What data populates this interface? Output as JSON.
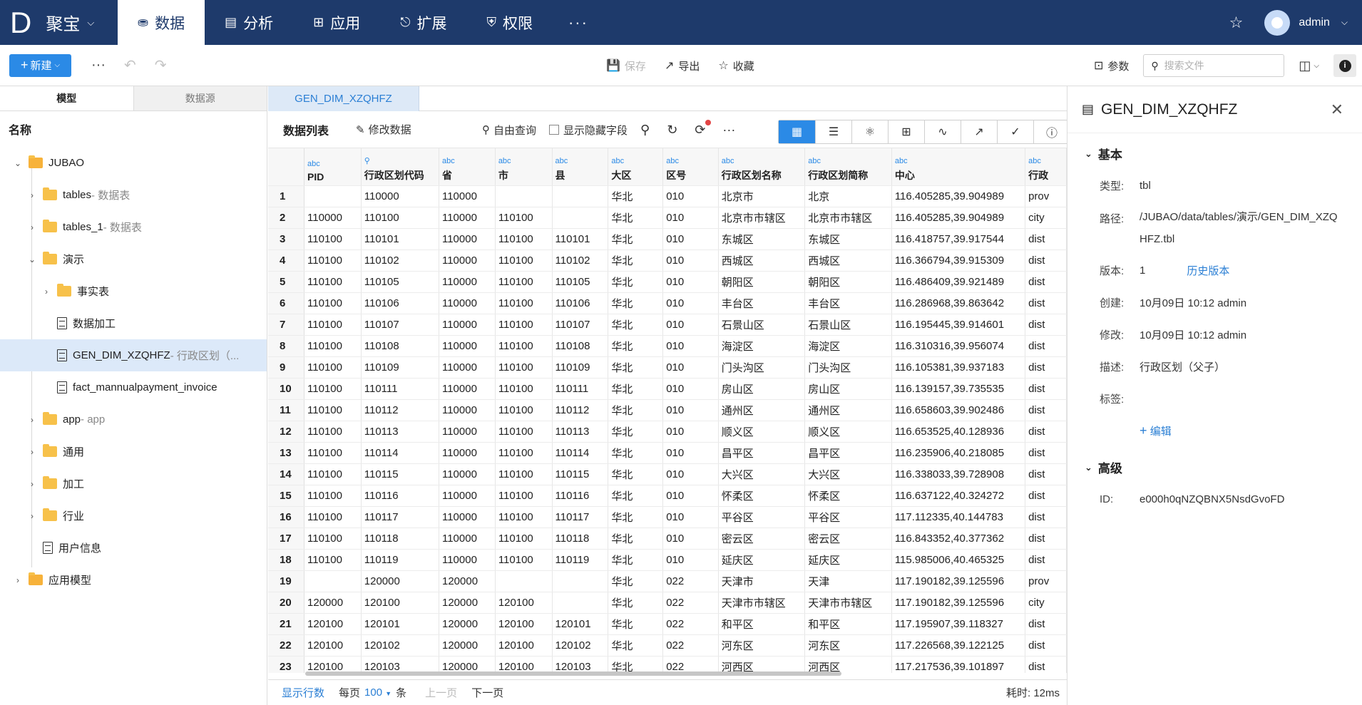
{
  "app": {
    "logo_letter": "D",
    "brand": "聚宝",
    "nav_tabs": [
      {
        "label": "数据",
        "icon": "database-icon"
      },
      {
        "label": "分析",
        "icon": "bar-chart-icon"
      },
      {
        "label": "应用",
        "icon": "apps-icon"
      },
      {
        "label": "扩展",
        "icon": "extension-icon"
      },
      {
        "label": "权限",
        "icon": "shield-icon"
      }
    ],
    "more": "···",
    "user": "admin"
  },
  "toolbar": {
    "new_label": "新建",
    "save_label": "保存",
    "export_label": "导出",
    "favorite_label": "收藏",
    "params_label": "参数",
    "search_placeholder": "搜索文件"
  },
  "left_panel": {
    "tabs": [
      "模型",
      "数据源"
    ],
    "header": "名称",
    "tree": [
      {
        "label": "JUBAO",
        "sub": ""
      },
      {
        "label": "tables",
        "sub": " - 数据表"
      },
      {
        "label": "tables_1",
        "sub": " - 数据表"
      },
      {
        "label": "演示",
        "sub": ""
      },
      {
        "label": "事实表",
        "sub": ""
      },
      {
        "label": "数据加工",
        "sub": ""
      },
      {
        "label": "GEN_DIM_XZQHFZ",
        "sub": " - 行政区划（..."
      },
      {
        "label": "fact_mannualpayment_invoice",
        "sub": ""
      },
      {
        "label": "app",
        "sub": " - app"
      },
      {
        "label": "通用",
        "sub": ""
      },
      {
        "label": "加工",
        "sub": ""
      },
      {
        "label": "行业",
        "sub": ""
      },
      {
        "label": "用户信息",
        "sub": ""
      },
      {
        "label": "应用模型",
        "sub": ""
      }
    ]
  },
  "center": {
    "doc_tab": "GEN_DIM_XZQHFZ",
    "view_title": "数据列表",
    "edit_data": "修改数据",
    "free_query": "自由查询",
    "show_hidden": "显示隐藏字段",
    "type_tag": "abc",
    "columns": [
      "PID",
      "行政区划代码",
      "省",
      "市",
      "县",
      "大区",
      "区号",
      "行政区划名称",
      "行政区划简称",
      "中心",
      "行政"
    ],
    "rows": [
      [
        "1",
        "",
        "110000",
        "110000",
        "",
        "",
        "华北",
        "010",
        "北京市",
        "北京",
        "116.405285,39.904989",
        "prov"
      ],
      [
        "2",
        "110000",
        "110100",
        "110000",
        "110100",
        "",
        "华北",
        "010",
        "北京市市辖区",
        "北京市市辖区",
        "116.405285,39.904989",
        "city"
      ],
      [
        "3",
        "110100",
        "110101",
        "110000",
        "110100",
        "110101",
        "华北",
        "010",
        "东城区",
        "东城区",
        "116.418757,39.917544",
        "dist"
      ],
      [
        "4",
        "110100",
        "110102",
        "110000",
        "110100",
        "110102",
        "华北",
        "010",
        "西城区",
        "西城区",
        "116.366794,39.915309",
        "dist"
      ],
      [
        "5",
        "110100",
        "110105",
        "110000",
        "110100",
        "110105",
        "华北",
        "010",
        "朝阳区",
        "朝阳区",
        "116.486409,39.921489",
        "dist"
      ],
      [
        "6",
        "110100",
        "110106",
        "110000",
        "110100",
        "110106",
        "华北",
        "010",
        "丰台区",
        "丰台区",
        "116.286968,39.863642",
        "dist"
      ],
      [
        "7",
        "110100",
        "110107",
        "110000",
        "110100",
        "110107",
        "华北",
        "010",
        "石景山区",
        "石景山区",
        "116.195445,39.914601",
        "dist"
      ],
      [
        "8",
        "110100",
        "110108",
        "110000",
        "110100",
        "110108",
        "华北",
        "010",
        "海淀区",
        "海淀区",
        "116.310316,39.956074",
        "dist"
      ],
      [
        "9",
        "110100",
        "110109",
        "110000",
        "110100",
        "110109",
        "华北",
        "010",
        "门头沟区",
        "门头沟区",
        "116.105381,39.937183",
        "dist"
      ],
      [
        "10",
        "110100",
        "110111",
        "110000",
        "110100",
        "110111",
        "华北",
        "010",
        "房山区",
        "房山区",
        "116.139157,39.735535",
        "dist"
      ],
      [
        "11",
        "110100",
        "110112",
        "110000",
        "110100",
        "110112",
        "华北",
        "010",
        "通州区",
        "通州区",
        "116.658603,39.902486",
        "dist"
      ],
      [
        "12",
        "110100",
        "110113",
        "110000",
        "110100",
        "110113",
        "华北",
        "010",
        "顺义区",
        "顺义区",
        "116.653525,40.128936",
        "dist"
      ],
      [
        "13",
        "110100",
        "110114",
        "110000",
        "110100",
        "110114",
        "华北",
        "010",
        "昌平区",
        "昌平区",
        "116.235906,40.218085",
        "dist"
      ],
      [
        "14",
        "110100",
        "110115",
        "110000",
        "110100",
        "110115",
        "华北",
        "010",
        "大兴区",
        "大兴区",
        "116.338033,39.728908",
        "dist"
      ],
      [
        "15",
        "110100",
        "110116",
        "110000",
        "110100",
        "110116",
        "华北",
        "010",
        "怀柔区",
        "怀柔区",
        "116.637122,40.324272",
        "dist"
      ],
      [
        "16",
        "110100",
        "110117",
        "110000",
        "110100",
        "110117",
        "华北",
        "010",
        "平谷区",
        "平谷区",
        "117.112335,40.144783",
        "dist"
      ],
      [
        "17",
        "110100",
        "110118",
        "110000",
        "110100",
        "110118",
        "华北",
        "010",
        "密云区",
        "密云区",
        "116.843352,40.377362",
        "dist"
      ],
      [
        "18",
        "110100",
        "110119",
        "110000",
        "110100",
        "110119",
        "华北",
        "010",
        "延庆区",
        "延庆区",
        "115.985006,40.465325",
        "dist"
      ],
      [
        "19",
        "",
        "120000",
        "120000",
        "",
        "",
        "华北",
        "022",
        "天津市",
        "天津",
        "117.190182,39.125596",
        "prov"
      ],
      [
        "20",
        "120000",
        "120100",
        "120000",
        "120100",
        "",
        "华北",
        "022",
        "天津市市辖区",
        "天津市市辖区",
        "117.190182,39.125596",
        "city"
      ],
      [
        "21",
        "120100",
        "120101",
        "120000",
        "120100",
        "120101",
        "华北",
        "022",
        "和平区",
        "和平区",
        "117.195907,39.118327",
        "dist"
      ],
      [
        "22",
        "120100",
        "120102",
        "120000",
        "120100",
        "120102",
        "华北",
        "022",
        "河东区",
        "河东区",
        "117.226568,39.122125",
        "dist"
      ],
      [
        "23",
        "120100",
        "120103",
        "120000",
        "120100",
        "120103",
        "华北",
        "022",
        "河西区",
        "河西区",
        "117.217536,39.101897",
        "dist"
      ]
    ],
    "footer": {
      "show_rows": "显示行数",
      "per_page": "每页",
      "page_size": "100",
      "unit": "条",
      "prev": "上一页",
      "next": "下一页",
      "elapsed": "耗时: 12ms"
    }
  },
  "right_panel": {
    "title": "GEN_DIM_XZQHFZ",
    "basic_section": "基本",
    "type_label": "类型:",
    "type_value": "tbl",
    "path_label": "路径:",
    "path_value": "/JUBAO/data/tables/演示/GEN_DIM_XZQHFZ.tbl",
    "version_label": "版本:",
    "version_value": "1",
    "history_link": "历史版本",
    "created_label": "创建:",
    "created_value": "10月09日 10:12 admin",
    "modified_label": "修改:",
    "modified_value": "10月09日 10:12 admin",
    "desc_label": "描述:",
    "desc_value": "行政区划（父子）",
    "tags_label": "标签:",
    "edit_link": "编辑",
    "advanced_section": "高级",
    "id_label": "ID:",
    "id_value": "e000h0qNZQBNX5NsdGvoFD"
  },
  "colors": {
    "nav_bg": "#1e3a6b",
    "accent": "#2b8ae6",
    "link": "#2b7fd4",
    "selected_row": "#dce9f9"
  }
}
